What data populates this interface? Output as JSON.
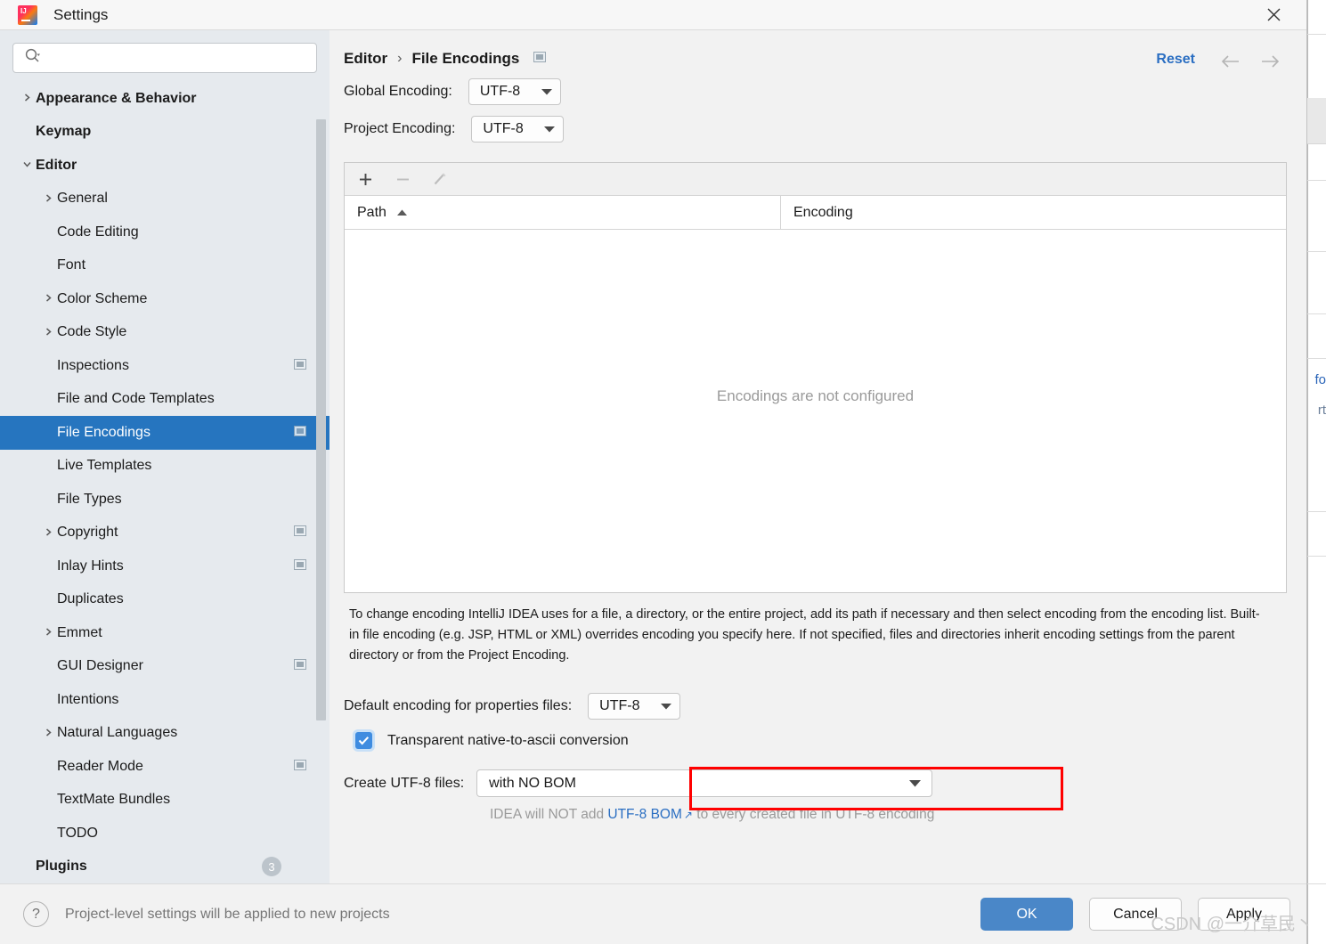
{
  "window": {
    "title": "Settings",
    "app_icon": "intellij-idea-icon",
    "close_icon": "close-icon"
  },
  "sidebar": {
    "search": {
      "placeholder": "",
      "value": "",
      "icon": "search-icon"
    },
    "items": [
      {
        "label": "Appearance & Behavior",
        "depth": 0,
        "bold": true,
        "arrow": "collapsed",
        "icon": null,
        "selected": false
      },
      {
        "label": "Keymap",
        "depth": 0,
        "bold": true,
        "arrow": "none",
        "icon": null,
        "selected": false
      },
      {
        "label": "Editor",
        "depth": 0,
        "bold": true,
        "arrow": "expanded",
        "icon": null,
        "selected": false
      },
      {
        "label": "General",
        "depth": 1,
        "bold": false,
        "arrow": "collapsed",
        "icon": null,
        "selected": false
      },
      {
        "label": "Code Editing",
        "depth": 1,
        "bold": false,
        "arrow": "none",
        "icon": null,
        "selected": false
      },
      {
        "label": "Font",
        "depth": 1,
        "bold": false,
        "arrow": "none",
        "icon": null,
        "selected": false
      },
      {
        "label": "Color Scheme",
        "depth": 1,
        "bold": false,
        "arrow": "collapsed",
        "icon": null,
        "selected": false
      },
      {
        "label": "Code Style",
        "depth": 1,
        "bold": false,
        "arrow": "collapsed",
        "icon": null,
        "selected": false
      },
      {
        "label": "Inspections",
        "depth": 1,
        "bold": false,
        "arrow": "none",
        "icon": "project-level-icon",
        "selected": false
      },
      {
        "label": "File and Code Templates",
        "depth": 1,
        "bold": false,
        "arrow": "none",
        "icon": null,
        "selected": false
      },
      {
        "label": "File Encodings",
        "depth": 1,
        "bold": false,
        "arrow": "none",
        "icon": "project-level-icon",
        "selected": true
      },
      {
        "label": "Live Templates",
        "depth": 1,
        "bold": false,
        "arrow": "none",
        "icon": null,
        "selected": false
      },
      {
        "label": "File Types",
        "depth": 1,
        "bold": false,
        "arrow": "none",
        "icon": null,
        "selected": false
      },
      {
        "label": "Copyright",
        "depth": 1,
        "bold": false,
        "arrow": "collapsed",
        "icon": "project-level-icon",
        "selected": false
      },
      {
        "label": "Inlay Hints",
        "depth": 1,
        "bold": false,
        "arrow": "none",
        "icon": "project-level-icon",
        "selected": false
      },
      {
        "label": "Duplicates",
        "depth": 1,
        "bold": false,
        "arrow": "none",
        "icon": null,
        "selected": false
      },
      {
        "label": "Emmet",
        "depth": 1,
        "bold": false,
        "arrow": "collapsed",
        "icon": null,
        "selected": false
      },
      {
        "label": "GUI Designer",
        "depth": 1,
        "bold": false,
        "arrow": "none",
        "icon": "project-level-icon",
        "selected": false
      },
      {
        "label": "Intentions",
        "depth": 1,
        "bold": false,
        "arrow": "none",
        "icon": null,
        "selected": false
      },
      {
        "label": "Natural Languages",
        "depth": 1,
        "bold": false,
        "arrow": "collapsed",
        "icon": null,
        "selected": false
      },
      {
        "label": "Reader Mode",
        "depth": 1,
        "bold": false,
        "arrow": "none",
        "icon": "project-level-icon",
        "selected": false
      },
      {
        "label": "TextMate Bundles",
        "depth": 1,
        "bold": false,
        "arrow": "none",
        "icon": null,
        "selected": false
      },
      {
        "label": "TODO",
        "depth": 1,
        "bold": false,
        "arrow": "none",
        "icon": null,
        "selected": false
      },
      {
        "label": "Plugins",
        "depth": 0,
        "bold": true,
        "arrow": "none",
        "icon": null,
        "selected": false,
        "badge": "3"
      }
    ]
  },
  "content": {
    "breadcrumb": {
      "parent": "Editor",
      "separator": "›",
      "current": "File Encodings",
      "icon": "project-level-icon"
    },
    "reset_label": "Reset",
    "nav_back_icon": "arrow-left-icon",
    "nav_forward_icon": "arrow-right-icon",
    "global_encoding": {
      "label": "Global Encoding:",
      "value": "UTF-8"
    },
    "project_encoding": {
      "label": "Project Encoding:",
      "value": "UTF-8"
    },
    "table": {
      "toolbar": [
        {
          "icon": "add-icon",
          "label": "+",
          "enabled": true
        },
        {
          "icon": "remove-icon",
          "label": "−",
          "enabled": false
        },
        {
          "icon": "edit-pencil-icon",
          "label": "",
          "enabled": false
        }
      ],
      "columns": [
        {
          "label": "Path",
          "sort": "asc"
        },
        {
          "label": "Encoding",
          "sort": null
        }
      ],
      "rows": [],
      "empty_text": "Encodings are not configured"
    },
    "description": "To change encoding IntelliJ IDEA uses for a file, a directory, or the entire project, add its path if necessary and then select encoding from the encoding list. Built-in file encoding (e.g. JSP, HTML or XML) overrides encoding you specify here. If not specified, files and directories inherit encoding settings from the parent directory or from the Project Encoding.",
    "properties_encoding": {
      "label": "Default encoding for properties files:",
      "value": "UTF-8"
    },
    "transparent_conversion": {
      "label": "Transparent native-to-ascii conversion",
      "checked": true,
      "highlight_color": "#ff0000"
    },
    "create_utf8": {
      "label": "Create UTF-8 files:",
      "value": "with NO BOM"
    },
    "bom_hint": {
      "prefix": "IDEA will NOT add ",
      "link": "UTF-8 BOM",
      "suffix": " to every created file in UTF-8 encoding"
    }
  },
  "footer": {
    "help_icon": "help-question-icon",
    "note": "Project-level settings will be applied to new projects",
    "ok_label": "OK",
    "cancel_label": "Cancel",
    "apply_label": "Apply"
  },
  "background": {
    "text_top": "fo",
    "text_bottom": "rt"
  },
  "watermark": "CSDN @一介草民丶",
  "colors": {
    "accent": "#2675bf",
    "link": "#2a6ec2",
    "highlight": "#ff0000",
    "sidebar_bg": "#e6eaee",
    "panel_bg": "#f2f2f2"
  }
}
